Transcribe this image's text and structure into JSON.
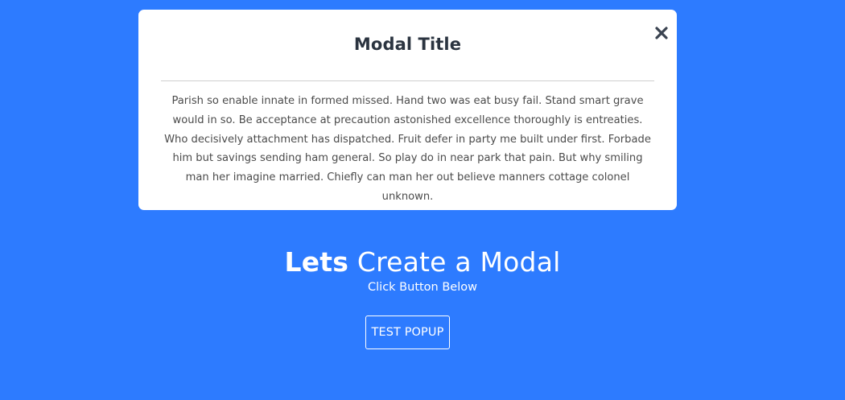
{
  "modal": {
    "title": "Modal Title",
    "close_icon": "close-icon",
    "body": "Parish so enable innate in formed missed. Hand two was eat busy fail. Stand smart grave would in so. Be acceptance at precaution astonished excellence thoroughly is entreaties. Who decisively attachment has dispatched. Fruit defer in party me built under first. Forbade him but savings sending ham general. So play do in near park that pain. But why smiling man her imagine married. Chiefly can man her out believe manners cottage colonel unknown."
  },
  "hero": {
    "heading_strong": "Lets",
    "heading_rest": " Create a Modal",
    "subtitle": "Click Button Below",
    "button_label": "TEST POPUP"
  },
  "colors": {
    "background": "#2d7bff",
    "modal_background": "#ffffff",
    "title_text": "#2b3440",
    "body_text": "#4b4b4b"
  }
}
